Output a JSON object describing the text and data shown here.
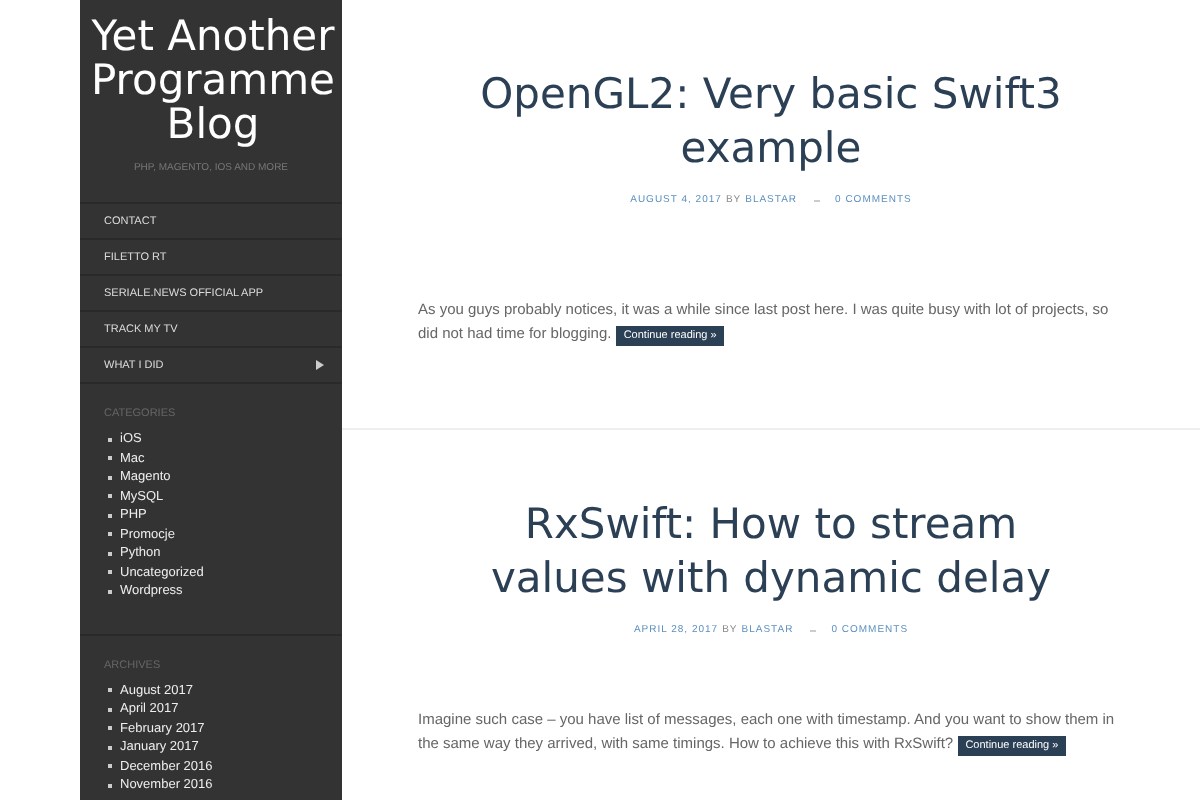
{
  "sidebar": {
    "site_title": "Yet Another Programme Blog",
    "tagline": "PHP, MAGENTO, IOS AND MORE",
    "menu": [
      {
        "label": "CONTACT",
        "has_submenu": false
      },
      {
        "label": "FILETTO RT",
        "has_submenu": false
      },
      {
        "label": "SERIALE.NEWS OFFICIAL APP",
        "has_submenu": false
      },
      {
        "label": "TRACK MY TV",
        "has_submenu": false
      },
      {
        "label": "WHAT I DID",
        "has_submenu": true
      }
    ],
    "widgets": [
      {
        "title": "CATEGORIES",
        "items": [
          "iOS",
          "Mac",
          "Magento",
          "MySQL",
          "PHP",
          "Promocje",
          "Python",
          "Uncategorized",
          "Wordpress"
        ]
      },
      {
        "title": "ARCHIVES",
        "items": [
          "August 2017",
          "April 2017",
          "February 2017",
          "January 2017",
          "December 2016",
          "November 2016"
        ]
      }
    ]
  },
  "posts": [
    {
      "title": "OpenGL2: Very basic Swift3 example",
      "date": "AUGUST 4, 2017",
      "by": "BY",
      "author": "BLASTAR",
      "comments": "0 COMMENTS",
      "excerpt": "As you guys probably notices, it was a while since last post here. I was quite busy with lot of projects, so did not had time for blogging.",
      "more": "Continue reading »"
    },
    {
      "title": "RxSwift: How to stream values with dynamic delay",
      "date": "APRIL 28, 2017",
      "by": "BY",
      "author": "BLASTAR",
      "comments": "0 COMMENTS",
      "excerpt": "Imagine such case – you have list of messages, each one with timestamp. And you want to show them in the same way they arrived, with same timings. How to achieve this with RxSwift?",
      "more": "Continue reading »"
    }
  ]
}
